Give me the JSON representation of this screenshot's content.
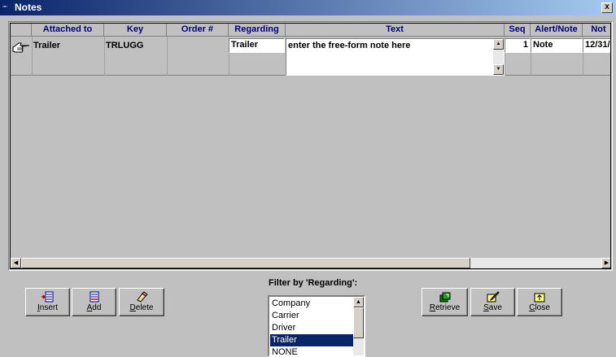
{
  "window": {
    "title": "Notes",
    "close_glyph": "x"
  },
  "grid": {
    "columns": [
      {
        "label": ""
      },
      {
        "label": "Attached to"
      },
      {
        "label": "Key"
      },
      {
        "label": "Order #"
      },
      {
        "label": "Regarding"
      },
      {
        "label": "Text"
      },
      {
        "label": "Seq"
      },
      {
        "label": "Alert/Note"
      },
      {
        "label": "Not"
      }
    ],
    "row": {
      "attached_to": "Trailer",
      "key": "TRLUGG",
      "order": "",
      "regarding": "Trailer",
      "text": "enter the free-form note here",
      "seq": "1",
      "alert_note": "Note",
      "not": "12/31/"
    }
  },
  "buttons": {
    "insert": {
      "prefix": "",
      "key": "I",
      "rest": "nsert"
    },
    "add": {
      "prefix": "",
      "key": "A",
      "rest": "dd"
    },
    "delete": {
      "prefix": "",
      "key": "D",
      "rest": "elete"
    },
    "retrieve": {
      "prefix": "",
      "key": "R",
      "rest": "etrieve"
    },
    "save": {
      "prefix": "",
      "key": "S",
      "rest": "ave"
    },
    "close": {
      "prefix": "",
      "key": "C",
      "rest": "lose"
    }
  },
  "filter": {
    "label": "Filter by 'Regarding':",
    "options": [
      "Company",
      "Carrier",
      "Driver",
      "Trailer",
      "NONE"
    ],
    "selected": "Trailer"
  },
  "colors": {
    "title_start": "#0a246a",
    "title_end": "#a6caf0",
    "header_text": "#000080",
    "selection": "#0a246a"
  },
  "icons": [
    "notes-app-icon",
    "pointing-hand-icon",
    "insert-row-icon",
    "add-row-icon",
    "eraser-icon",
    "retrieve-icon",
    "save-pencil-icon",
    "close-folder-icon"
  ]
}
